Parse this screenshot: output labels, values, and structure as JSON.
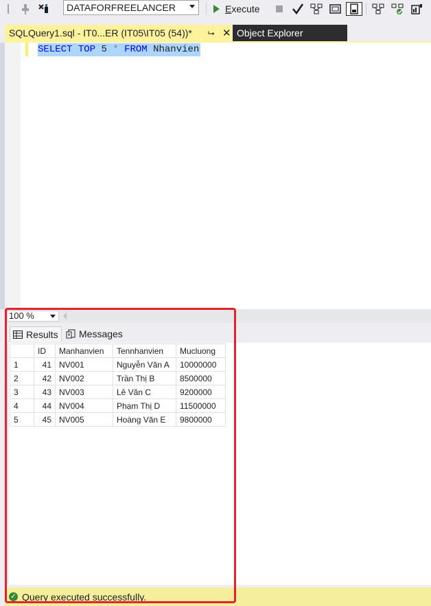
{
  "toolbar": {
    "database": "DATAFORFREELANCER",
    "execute_prefix": "",
    "execute_mnemonic": "E",
    "execute_rest": "xecute"
  },
  "tabs": {
    "query_tab": "SQLQuery1.sql - IT0...ER (IT05\\IT05 (54))*",
    "object_explorer": "Object Explorer"
  },
  "editor": {
    "sql": {
      "kw_select": "SELECT",
      "kw_top": "TOP",
      "num": "5",
      "star": "*",
      "kw_from": "FROM",
      "table": "Nhanvien"
    }
  },
  "zoom": {
    "value": "100 %"
  },
  "results_tabs": {
    "results": "Results",
    "messages": "Messages"
  },
  "grid": {
    "columns": [
      "ID",
      "Manhanvien",
      "Tennhanvien",
      "Mucluong"
    ],
    "rows": [
      {
        "num": "1",
        "id": "41",
        "ma": "NV001",
        "ten": "Nguyễn Văn A",
        "muc": "10000000"
      },
      {
        "num": "2",
        "id": "42",
        "ma": "NV002",
        "ten": "Trần Thị B",
        "muc": "8500000"
      },
      {
        "num": "3",
        "id": "43",
        "ma": "NV003",
        "ten": "Lê Văn C",
        "muc": "9200000"
      },
      {
        "num": "4",
        "id": "44",
        "ma": "NV004",
        "ten": "Phạm Thị D",
        "muc": "11500000"
      },
      {
        "num": "5",
        "id": "45",
        "ma": "NV005",
        "ten": "Hoàng Văn E",
        "muc": "9800000"
      }
    ]
  },
  "status": {
    "message": "Query executed successfully."
  },
  "colors": {
    "tab_active": "#FFF29D",
    "keyword": "#0000FF",
    "selection": "#ADD6FF",
    "status_bar": "#F4EE9D",
    "annotation": "#E5212B"
  }
}
